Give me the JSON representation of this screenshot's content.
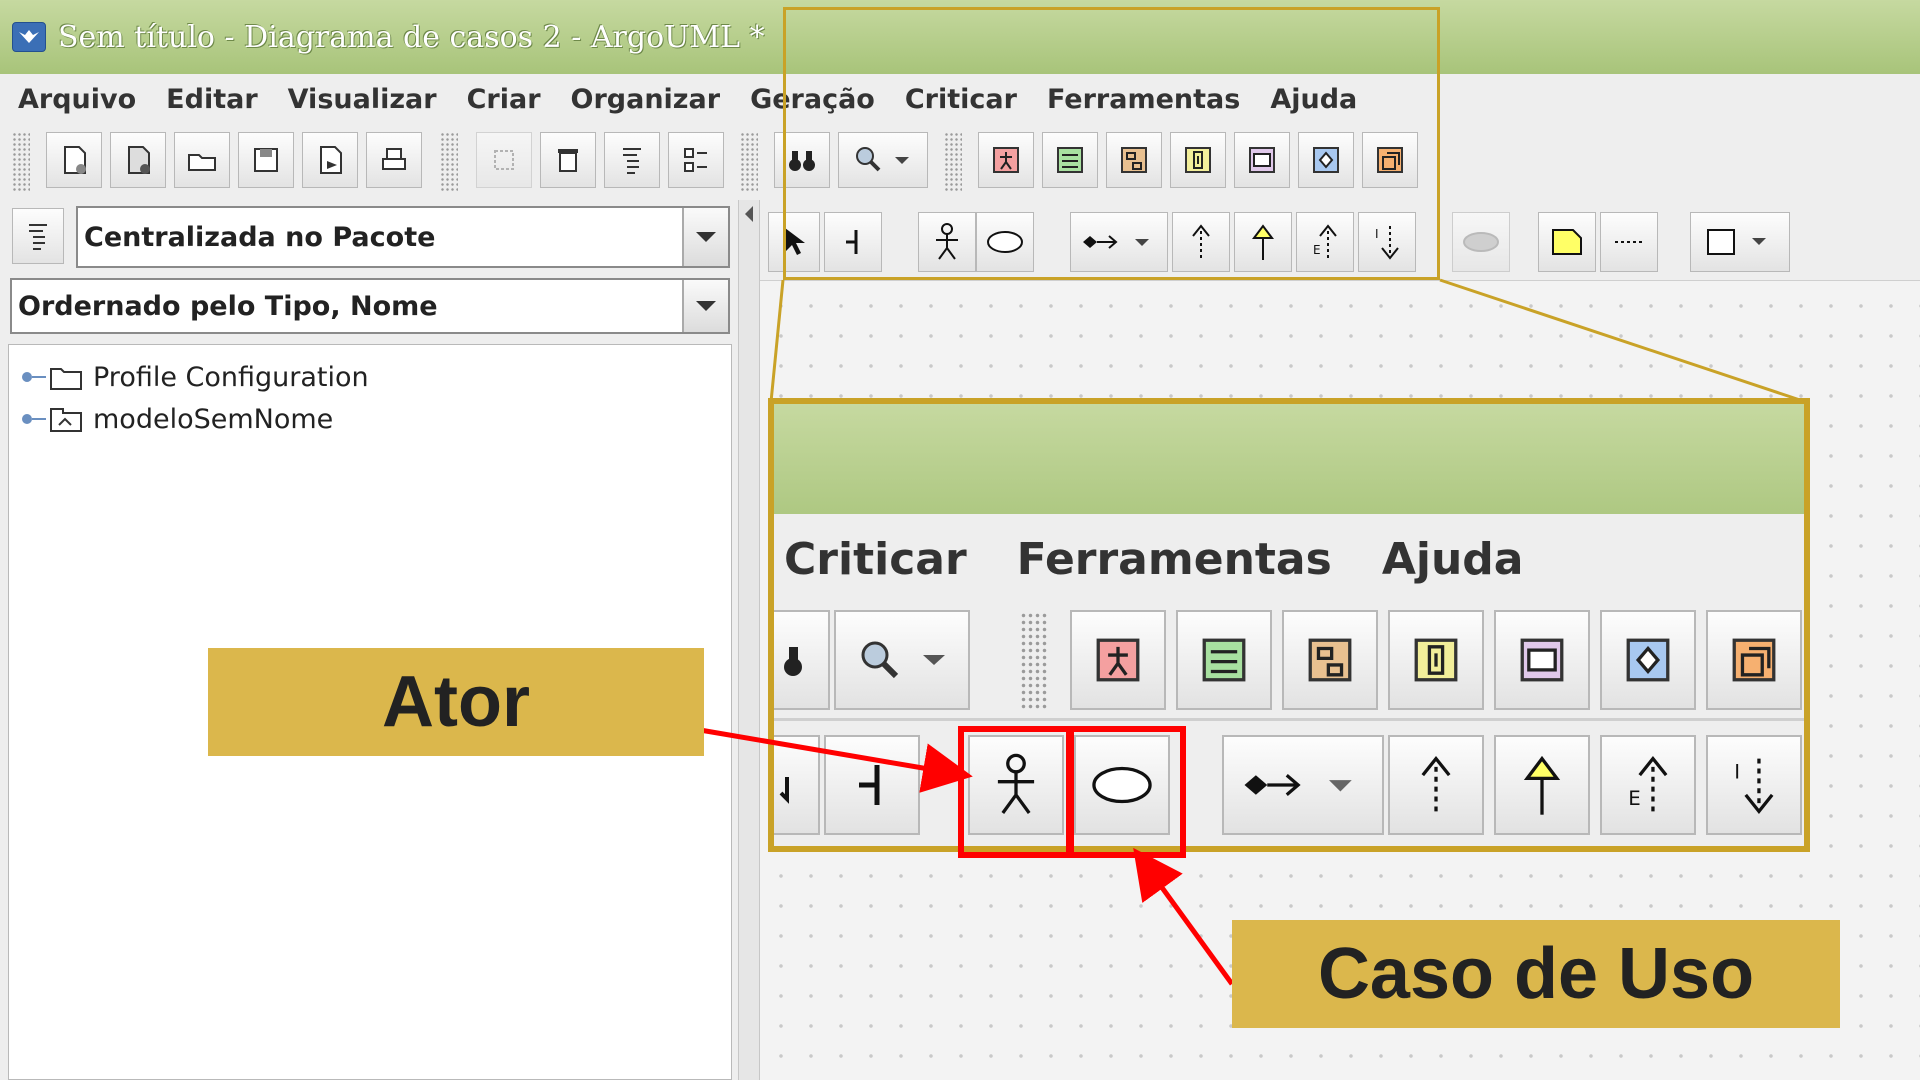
{
  "window": {
    "title": "Sem título - Diagrama de casos 2 - ArgoUML *"
  },
  "menu": [
    "Arquivo",
    "Editar",
    "Visualizar",
    "Criar",
    "Organizar",
    "Geração",
    "Criticar",
    "Ferramentas",
    "Ajuda"
  ],
  "explorer": {
    "perspective": "Centralizada no Pacote",
    "ordering": "Ordernado pelo Tipo, Nome",
    "tree": [
      {
        "label": "Profile Configuration",
        "icon": "folder-icon"
      },
      {
        "label": "modeloSemNome",
        "icon": "package-icon"
      }
    ]
  },
  "zoom": {
    "menu": [
      "Criticar",
      "Ferramentas",
      "Ajuda"
    ]
  },
  "callouts": {
    "actor": "Ator",
    "use_case": "Caso de Uso"
  },
  "colors": {
    "title_bar": "#b5cd8a",
    "callout_gold": "#dbb74c",
    "frame_gold": "#c9a227",
    "highlight_red": "#ff0000"
  }
}
